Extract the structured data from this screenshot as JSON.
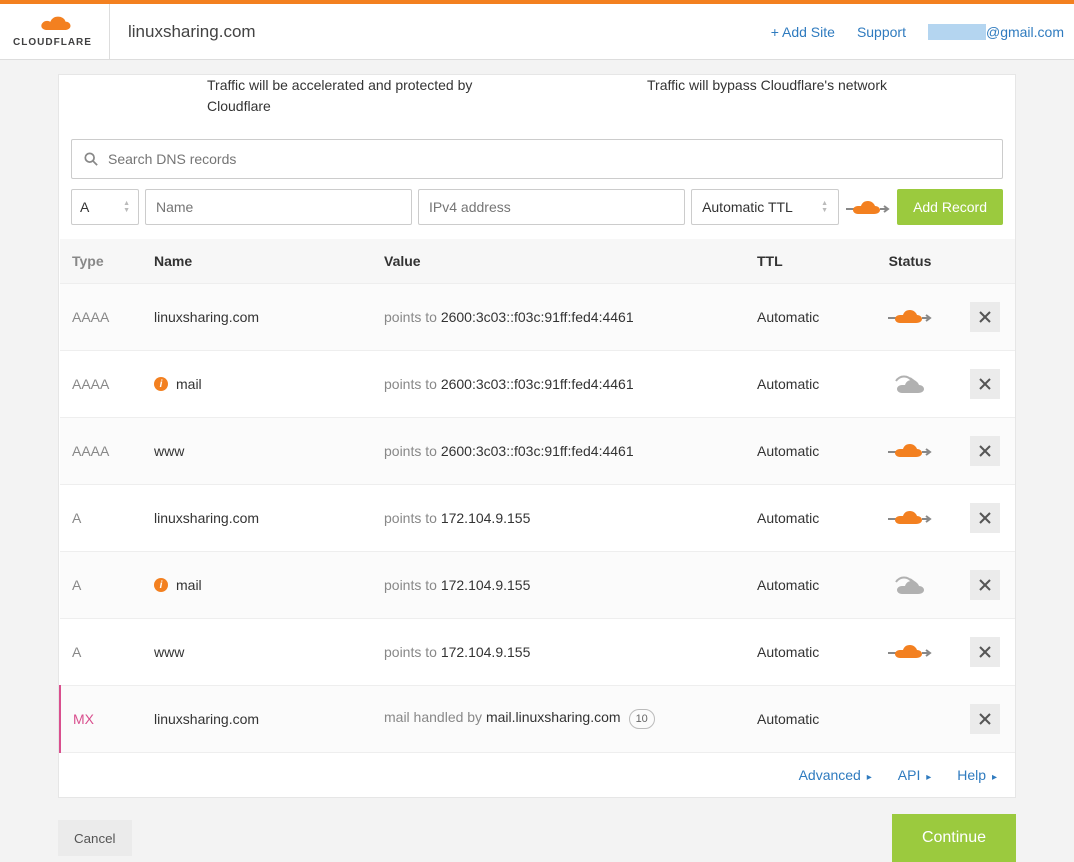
{
  "header": {
    "logo_text": "CLOUDFLARE",
    "domain": "linuxsharing.com",
    "add_site": "+ Add Site",
    "support": "Support",
    "user_email": "@gmail.com"
  },
  "info": {
    "left": "Traffic will be accelerated and protected by Cloudflare",
    "right": "Traffic will bypass Cloudflare's network"
  },
  "search": {
    "placeholder": "Search DNS records"
  },
  "new_record": {
    "type": "A",
    "name_placeholder": "Name",
    "value_placeholder": "IPv4 address",
    "ttl": "Automatic TTL",
    "add_label": "Add Record"
  },
  "table": {
    "headers": {
      "type": "Type",
      "name": "Name",
      "value": "Value",
      "ttl": "TTL",
      "status": "Status"
    },
    "rows": [
      {
        "type": "AAAA",
        "name": "linuxsharing.com",
        "warn": false,
        "value_prefix": "points to ",
        "value": "2600:3c03::f03c:91ff:fed4:4461",
        "ttl": "Automatic",
        "proxied": true
      },
      {
        "type": "AAAA",
        "name": "mail",
        "warn": true,
        "value_prefix": "points to ",
        "value": "2600:3c03::f03c:91ff:fed4:4461",
        "ttl": "Automatic",
        "proxied": false
      },
      {
        "type": "AAAA",
        "name": "www",
        "warn": false,
        "value_prefix": "points to ",
        "value": "2600:3c03::f03c:91ff:fed4:4461",
        "ttl": "Automatic",
        "proxied": true
      },
      {
        "type": "A",
        "name": "linuxsharing.com",
        "warn": false,
        "value_prefix": "points to ",
        "value": "172.104.9.155",
        "ttl": "Automatic",
        "proxied": true
      },
      {
        "type": "A",
        "name": "mail",
        "warn": true,
        "value_prefix": "points to ",
        "value": "172.104.9.155",
        "ttl": "Automatic",
        "proxied": false
      },
      {
        "type": "A",
        "name": "www",
        "warn": false,
        "value_prefix": "points to ",
        "value": "172.104.9.155",
        "ttl": "Automatic",
        "proxied": true
      },
      {
        "type": "MX",
        "name": "linuxsharing.com",
        "warn": false,
        "value_prefix": "mail handled by ",
        "value": "mail.linuxsharing.com",
        "priority": "10",
        "ttl": "Automatic",
        "proxied": null
      }
    ]
  },
  "footer_links": {
    "advanced": "Advanced",
    "api": "API",
    "help": "Help"
  },
  "actions": {
    "cancel": "Cancel",
    "continue": "Continue"
  }
}
